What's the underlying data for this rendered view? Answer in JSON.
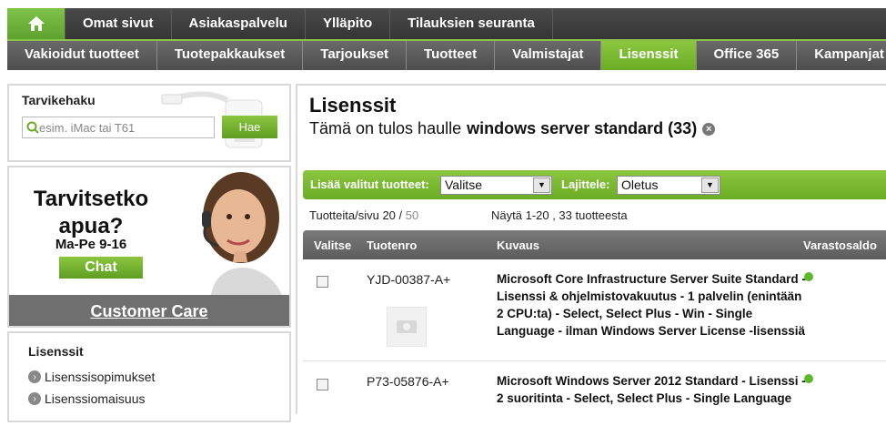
{
  "topnav": {
    "items": [
      "Omat sivut",
      "Asiakaspalvelu",
      "Ylläpito",
      "Tilauksien seuranta"
    ]
  },
  "subnav": {
    "items": [
      "Vakioidut tuotteet",
      "Tuotepakkaukset",
      "Tarjoukset",
      "Tuotteet",
      "Valmistajat",
      "Lisenssit",
      "Office 365",
      "Kampanjat"
    ],
    "active": "Lisenssit"
  },
  "search": {
    "title": "Tarvikehaku",
    "placeholder": "esim. iMac tai T61",
    "button": "Hae"
  },
  "help": {
    "title_line1": "Tarvitsetko",
    "title_line2": "apua?",
    "hours": "Ma-Pe 9-16",
    "chat": "Chat",
    "customer_care": "Customer Care"
  },
  "sidebar": {
    "title": "Lisenssit",
    "items": [
      "Lisenssisopimukset",
      "Lisenssiomaisuus"
    ]
  },
  "main": {
    "title": "Lisenssit",
    "result_prefix": "Tämä on tulos haulle",
    "result_query": "windows server standard (33)",
    "add_label": "Lisää valitut tuotteet:",
    "add_select": "Valitse",
    "sort_label": "Lajittele:",
    "sort_select": "Oletus",
    "per_page_label": "Tuotteita/sivu 20 /",
    "per_page_alt": "50",
    "showing": "Näytä 1-20 , 33 tuotteesta"
  },
  "table": {
    "headers": {
      "select": "Valitse",
      "product_no": "Tuotenro",
      "description": "Kuvaus",
      "stock": "Varastosaldo"
    },
    "rows": [
      {
        "product_no": "YJD-00387-A+",
        "description": "Microsoft Core Infrastructure Server Suite Standard - Lisenssi & ohjelmistovakuutus - 1 palvelin (enintään 2 CPU:ta) - Select, Select Plus - Win - Single Language - ilman Windows Server License -lisenssiä"
      },
      {
        "product_no": "P73-05876-A+",
        "description": "Microsoft Windows Server 2012 Standard - Lisenssi - 2 suoritinta - Select, Select Plus - Single Language"
      }
    ]
  },
  "colors": {
    "accent": "#8cc63f",
    "dark": "#4a4a4a",
    "stock_ok": "#5cb82e"
  }
}
